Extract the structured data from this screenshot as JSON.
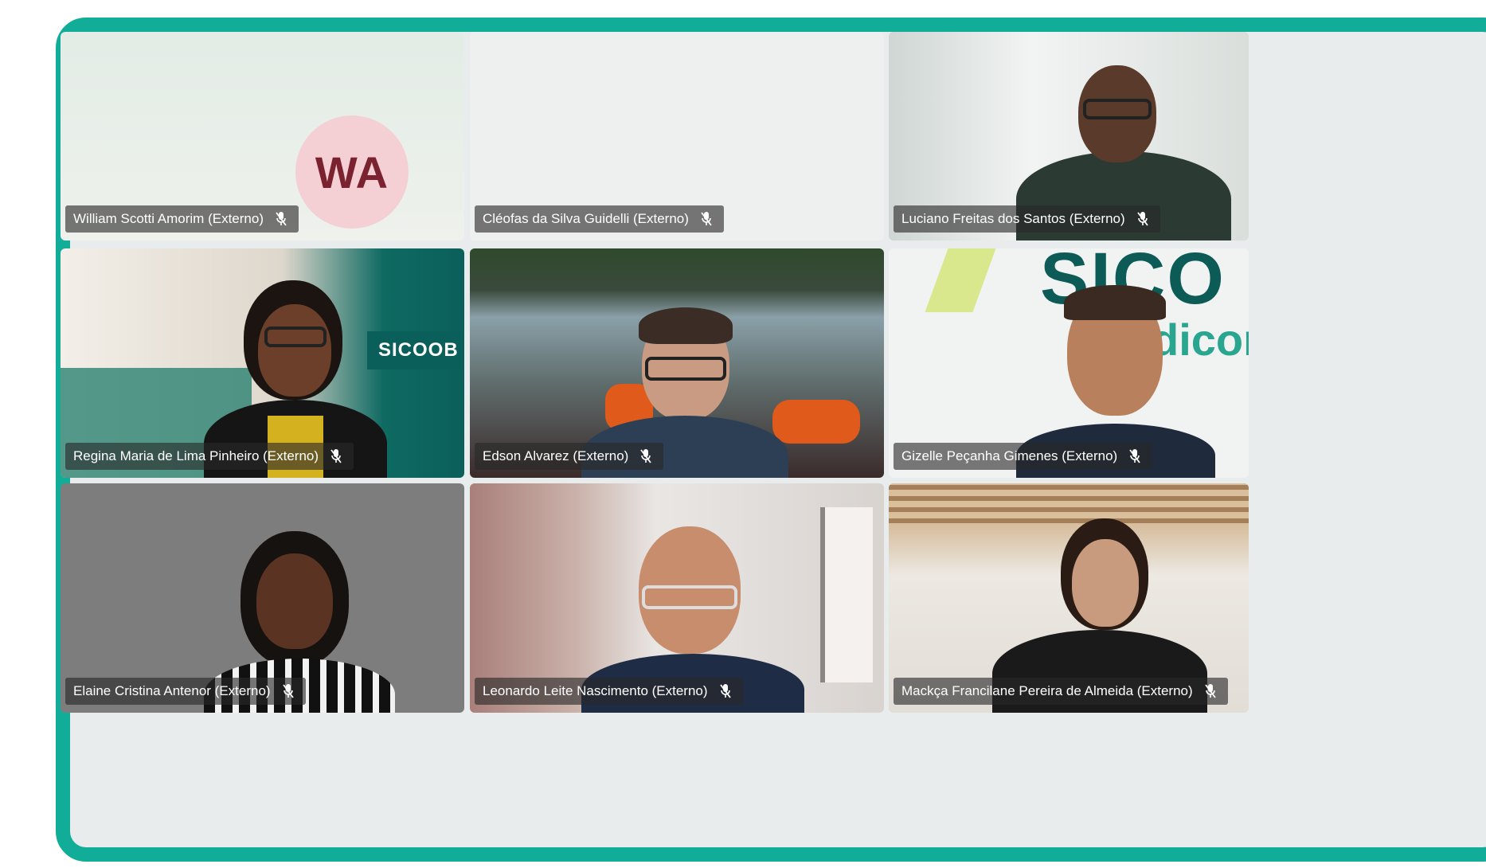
{
  "meeting": {
    "participants": [
      {
        "name": "William Scotti Amorim (Externo)",
        "initials": "WA",
        "muted": true
      },
      {
        "name": "Cléofas da Silva Guidelli (Externo)",
        "muted": true
      },
      {
        "name": "Luciano Freitas dos Santos (Externo)",
        "muted": true
      },
      {
        "name": "Regina Maria de Lima Pinheiro (Externo)",
        "muted": true
      },
      {
        "name": "Edson Alvarez (Externo)",
        "muted": true
      },
      {
        "name": "Gizelle Peçanha Gimenes (Externo)",
        "muted": true
      },
      {
        "name": "Elaine Cristina Antenor (Externo)",
        "muted": true
      },
      {
        "name": "Leonardo Leite Nascimento (Externo)",
        "muted": true
      },
      {
        "name": "Mackça Francilane Pereira de Almeida (Externo)",
        "muted": true
      }
    ],
    "background_text": {
      "regina_sign": "SICOOB",
      "gizelle_sign": "SICO",
      "gizelle_sign_sub": "dicon"
    }
  },
  "colors": {
    "frame_border": "#12ad98",
    "avatar_bg": "#f4cfd3",
    "avatar_text": "#7a2230"
  },
  "icons": {
    "muted": "microphone-off-icon"
  }
}
